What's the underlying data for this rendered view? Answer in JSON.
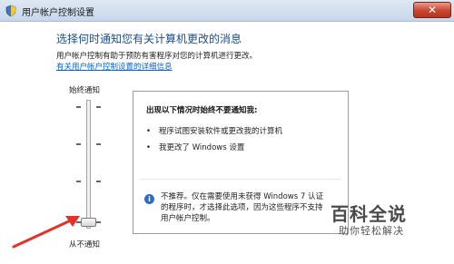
{
  "window": {
    "title": "用户帐户控制设置",
    "close_glyph": "✕"
  },
  "main": {
    "heading": "选择何时通知您有关计算机更改的消息",
    "description": "用户帐户控制有助于预防有害程序对您的计算机进行更改。",
    "link": "有关用户帐户控制设置的详细信息"
  },
  "slider": {
    "top_label": "始终通知",
    "bottom_label": "从不通知",
    "level": 0,
    "levels": 4
  },
  "panel": {
    "title": "出现以下情况时始终不要通知我:",
    "bullets": [
      "程序试图安装软件或更改我的计算机",
      "我更改了 Windows 设置"
    ],
    "bullet_glyph": "•",
    "info_glyph": "i",
    "note": "不推荐。仅在需要使用未获得 Windows 7 认证的程序时，才选择此选项，因为这些程序不支持用户帐户控制。"
  },
  "watermark": {
    "title": "百科全说",
    "subtitle": "助你轻松解决"
  },
  "colors": {
    "heading": "#1b4f8a",
    "link": "#0a64c8",
    "arrow": "#e0332b"
  }
}
